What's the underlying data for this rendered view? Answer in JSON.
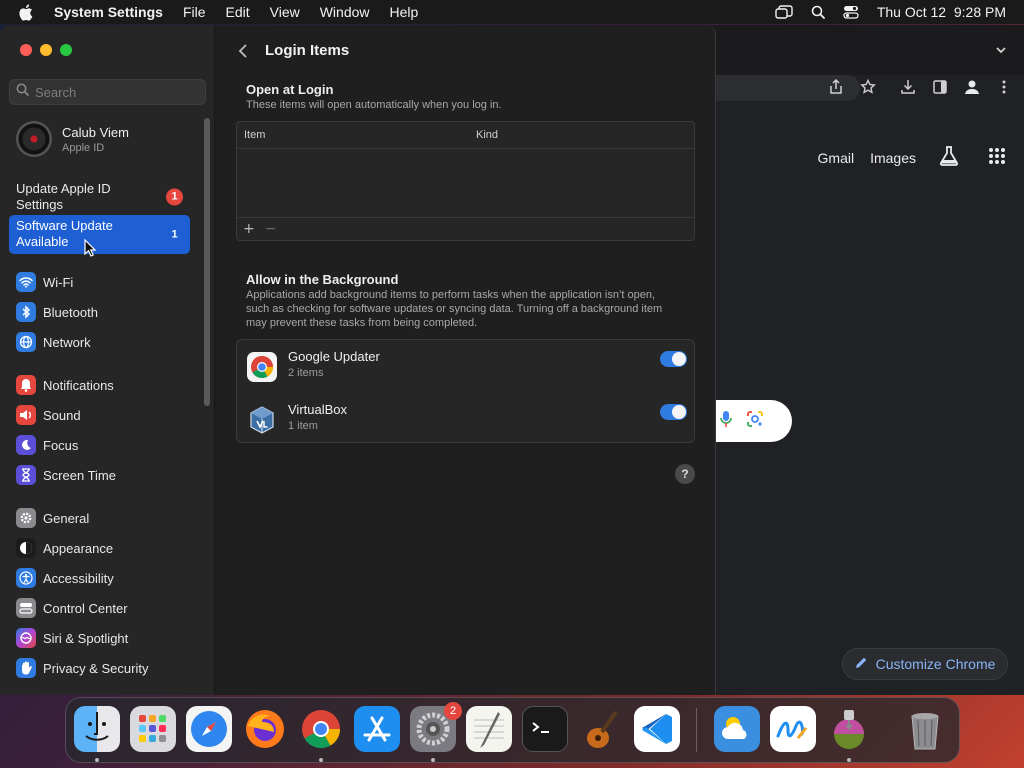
{
  "menubar": {
    "app_name": "System Settings",
    "items": [
      "File",
      "Edit",
      "View",
      "Window",
      "Help"
    ],
    "clock": "Thu Oct 12  9:28 PM",
    "icons": [
      "apple-icon",
      "window-switch-icon",
      "spotlight-search-icon",
      "control-center-icon"
    ]
  },
  "chrome": {
    "links": {
      "gmail": "Gmail",
      "images": "Images"
    },
    "customize_label": "Customize Chrome"
  },
  "sidebar": {
    "search_placeholder": "Search",
    "account": {
      "name": "Calub Viem",
      "sub": "Apple ID"
    },
    "alerts": [
      {
        "label": "Update Apple ID Settings",
        "badge": "1"
      },
      {
        "label": "Software Update Available",
        "badge": "1"
      }
    ],
    "group1": [
      {
        "label": "Wi-Fi",
        "icon": "wifi-icon",
        "color": "#2f7be0"
      },
      {
        "label": "Bluetooth",
        "icon": "bluetooth-icon",
        "color": "#2f7be0"
      },
      {
        "label": "Network",
        "icon": "globe-icon",
        "color": "#2f7be0"
      }
    ],
    "group2": [
      {
        "label": "Notifications",
        "icon": "bell-icon",
        "color": "#e5473f"
      },
      {
        "label": "Sound",
        "icon": "speaker-icon",
        "color": "#e5473f"
      },
      {
        "label": "Focus",
        "icon": "moon-icon",
        "color": "#5b4fd8"
      },
      {
        "label": "Screen Time",
        "icon": "hourglass-icon",
        "color": "#5b4fd8"
      }
    ],
    "group3": [
      {
        "label": "General",
        "icon": "gear-icon",
        "color": "#8a8a8e"
      },
      {
        "label": "Appearance",
        "icon": "appearance-icon",
        "color": "#1c1c1c"
      },
      {
        "label": "Accessibility",
        "icon": "accessibility-icon",
        "color": "#2f7be0"
      },
      {
        "label": "Control Center",
        "icon": "control-center-icon",
        "color": "#8a8a8e"
      },
      {
        "label": "Siri & Spotlight",
        "icon": "siri-icon",
        "color": "#b145d6"
      },
      {
        "label": "Privacy & Security",
        "icon": "hand-icon",
        "color": "#2f7be0"
      }
    ]
  },
  "main": {
    "title": "Login Items",
    "open_at_login": {
      "title": "Open at Login",
      "desc": "These items will open automatically when you log in.",
      "columns": {
        "item": "Item",
        "kind": "Kind"
      },
      "add_label": "+",
      "remove_label": "−"
    },
    "background": {
      "title": "Allow in the Background",
      "desc": "Applications add background items to perform tasks when the application isn’t open, such as checking for software updates or syncing data. Turning off a background item may prevent these tasks from being completed.",
      "items": [
        {
          "name": "Google Updater",
          "sub": "2 items",
          "icon": "chrome-icon",
          "enabled": true
        },
        {
          "name": "VirtualBox",
          "sub": "1 item",
          "icon": "virtualbox-icon",
          "enabled": true
        }
      ]
    },
    "help_label": "?"
  },
  "dock": {
    "apps": [
      {
        "name": "finder-icon",
        "color": "#3d9bf0"
      },
      {
        "name": "launchpad-icon",
        "color": "#d9d9de"
      },
      {
        "name": "safari-icon",
        "color": "#2f86f0"
      },
      {
        "name": "firefox-icon",
        "color": "#ff7a1a"
      },
      {
        "name": "chrome-icon",
        "color": "#ffffff"
      },
      {
        "name": "app-store-icon",
        "color": "#1f8ef1"
      },
      {
        "name": "system-settings-icon",
        "color": "#7a7a80",
        "badge": "2"
      },
      {
        "name": "textedit-icon",
        "color": "#f5f5f0"
      },
      {
        "name": "terminal-icon",
        "color": "#1a1a1a"
      },
      {
        "name": "garageband-icon",
        "color": "#2a2a2a"
      },
      {
        "name": "vscode-icon",
        "color": "#ffffff"
      },
      {
        "name": "weather-icon",
        "color": "#3a8fe0"
      },
      {
        "name": "freeform-icon",
        "color": "#ffffff"
      },
      {
        "name": "macos-installer-icon",
        "color": "#3b3b3b"
      },
      {
        "name": "trash-icon",
        "color": "#6d6d70"
      }
    ]
  }
}
